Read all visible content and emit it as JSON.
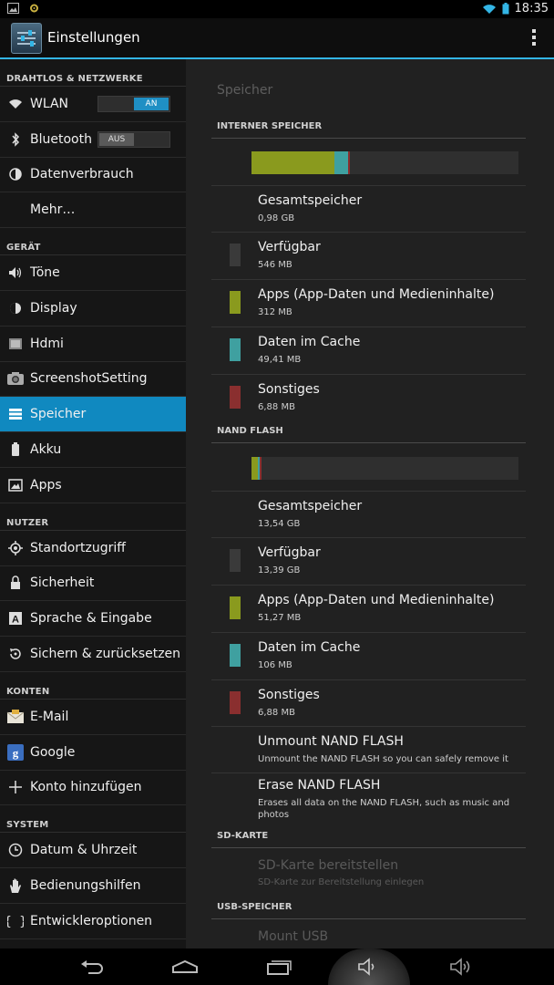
{
  "statusbar": {
    "time": "18:35"
  },
  "actionbar": {
    "title": "Einstellungen"
  },
  "sidebar": {
    "sections": [
      {
        "header": "DRAHTLOS & NETZWERKE",
        "items": [
          {
            "label": "WLAN",
            "icon": "wifi-icon",
            "toggle": "AN",
            "toggle_state": "on"
          },
          {
            "label": "Bluetooth",
            "icon": "bluetooth-icon",
            "toggle": "AUS",
            "toggle_state": "off"
          },
          {
            "label": "Datenverbrauch",
            "icon": "data-usage-icon"
          },
          {
            "label": "Mehr…",
            "icon": ""
          }
        ]
      },
      {
        "header": "GERÄT",
        "items": [
          {
            "label": "Töne",
            "icon": "speaker-icon"
          },
          {
            "label": "Display",
            "icon": "display-icon"
          },
          {
            "label": "Hdmi",
            "icon": "hdmi-icon"
          },
          {
            "label": "ScreenshotSetting",
            "icon": "camera-icon"
          },
          {
            "label": "Speicher",
            "icon": "storage-icon",
            "selected": true
          },
          {
            "label": "Akku",
            "icon": "battery-icon"
          },
          {
            "label": "Apps",
            "icon": "apps-icon"
          }
        ]
      },
      {
        "header": "NUTZER",
        "items": [
          {
            "label": "Standortzugriff",
            "icon": "location-icon"
          },
          {
            "label": "Sicherheit",
            "icon": "lock-icon"
          },
          {
            "label": "Sprache & Eingabe",
            "icon": "language-icon"
          },
          {
            "label": "Sichern & zurücksetzen",
            "icon": "backup-icon"
          }
        ]
      },
      {
        "header": "KONTEN",
        "items": [
          {
            "label": "E-Mail",
            "icon": "email-icon"
          },
          {
            "label": "Google",
            "icon": "google-icon"
          },
          {
            "label": "Konto hinzufügen",
            "icon": "plus-icon"
          }
        ]
      },
      {
        "header": "SYSTEM",
        "items": [
          {
            "label": "Datum & Uhrzeit",
            "icon": "clock-icon"
          },
          {
            "label": "Bedienungshilfen",
            "icon": "hand-icon"
          },
          {
            "label": "Entwickleroptionen",
            "icon": "braces-icon"
          }
        ]
      }
    ]
  },
  "main": {
    "title": "Speicher",
    "colors": {
      "available": "#3a3a3a",
      "apps": "#8a9a1e",
      "cache": "#3fa0a0",
      "other": "#8a2f2f"
    },
    "internal": {
      "header": "INTERNER SPEICHER",
      "bar": {
        "apps": 0.312,
        "cache": 0.049,
        "other": 0.007
      },
      "rows": [
        {
          "title": "Gesamtspeicher",
          "value": "0,98 GB"
        },
        {
          "title": "Verfügbar",
          "value": "546 MB"
        },
        {
          "title": "Apps (App-Daten und Medieninhalte)",
          "value": "312 MB"
        },
        {
          "title": "Daten im Cache",
          "value": "49,41 MB"
        },
        {
          "title": "Sonstiges",
          "value": "6,88 MB"
        }
      ]
    },
    "nand": {
      "header": "NAND FLASH",
      "bar": {
        "apps": 0.024,
        "cache": 0.008,
        "other": 0.006
      },
      "rows": [
        {
          "title": "Gesamtspeicher",
          "value": "13,54 GB"
        },
        {
          "title": "Verfügbar",
          "value": "13,39 GB"
        },
        {
          "title": "Apps (App-Daten und Medieninhalte)",
          "value": "51,27 MB"
        },
        {
          "title": "Daten im Cache",
          "value": "106 MB"
        },
        {
          "title": "Sonstiges",
          "value": "6,88 MB"
        }
      ],
      "unmount": {
        "title": "Unmount NAND FLASH",
        "summary": "Unmount the NAND FLASH so you can safely remove it"
      },
      "erase": {
        "title": "Erase NAND FLASH",
        "summary": "Erases all data on the NAND FLASH, such as music and photos"
      }
    },
    "sd": {
      "header": "SD-KARTE",
      "mount": {
        "title": "SD-Karte bereitstellen",
        "summary": "SD-Karte zur Bereitstellung einlegen"
      }
    },
    "usb": {
      "header": "USB-SPEICHER",
      "mount": {
        "title": "Mount USB"
      }
    }
  }
}
